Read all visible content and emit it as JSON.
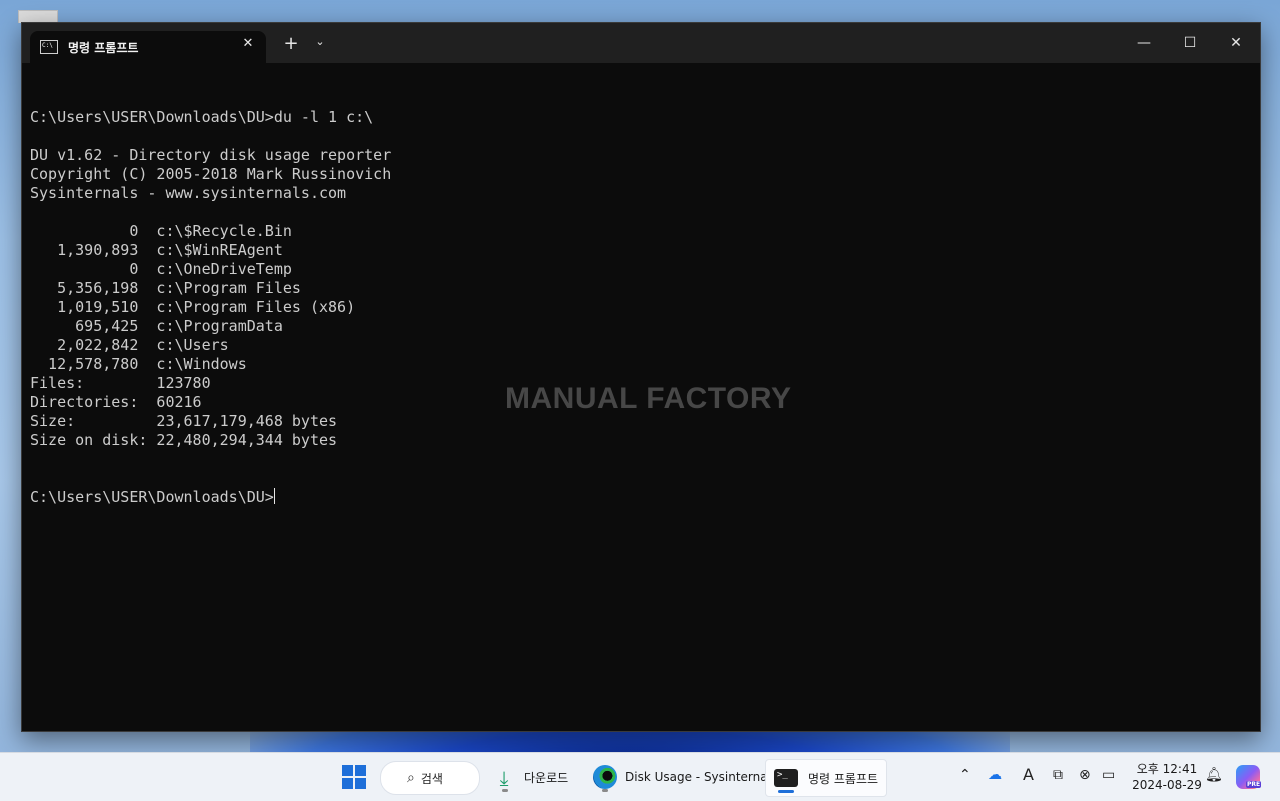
{
  "window": {
    "tab_title": "명령 프롬프트",
    "close_tab": "✕",
    "new_tab": "+",
    "dropdown": "⌄",
    "minimize": "—",
    "maximize": "☐",
    "close": "✕"
  },
  "console": {
    "lines": [
      "",
      "C:\\Users\\USER\\Downloads\\DU>du -l 1 c:\\",
      "",
      "DU v1.62 - Directory disk usage reporter",
      "Copyright (C) 2005-2018 Mark Russinovich",
      "Sysinternals - www.sysinternals.com",
      "",
      "           0  c:\\$Recycle.Bin",
      "   1,390,893  c:\\$WinREAgent",
      "           0  c:\\OneDriveTemp",
      "   5,356,198  c:\\Program Files",
      "   1,019,510  c:\\Program Files (x86)",
      "     695,425  c:\\ProgramData",
      "   2,022,842  c:\\Users",
      "  12,578,780  c:\\Windows",
      "Files:        123780",
      "Directories:  60216",
      "Size:         23,617,179,468 bytes",
      "Size on disk: 22,480,294,344 bytes",
      "",
      "",
      "C:\\Users\\USER\\Downloads\\DU>"
    ]
  },
  "watermark": "MANUAL FACTORY",
  "taskbar": {
    "search_label": "검색",
    "downloads_label": "다운로드",
    "edge_label": "Disk Usage - Sysinternal",
    "cmd_label": "명령 프롬프트",
    "clock_time": "오후 12:41",
    "clock_date": "2024-08-29",
    "copilot_badge": "PRE",
    "tray_icons": [
      "chevron-up-icon",
      "onedrive-icon",
      "ime-icon",
      "display-icon",
      "network-mute-icon",
      "battery-icon",
      "bell-icon"
    ]
  }
}
